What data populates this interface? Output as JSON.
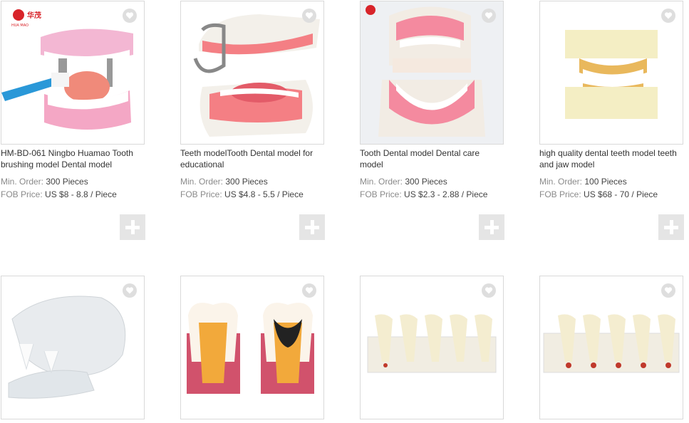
{
  "products": [
    {
      "title": "HM-BD-061 Ningbo Huamao Tooth brushing model Dental model",
      "min_order_label": "Min. Order:",
      "min_order": "300 Pieces",
      "price_label": "FOB Price:",
      "price": "US $8 - 8.8 / Piece",
      "logo_text": "华茂",
      "logo_sub": "HUA MAO"
    },
    {
      "title": "Teeth modelTooth Dental model for educational",
      "min_order_label": "Min. Order:",
      "min_order": "300 Pieces",
      "price_label": "FOB Price:",
      "price": "US $4.8 - 5.5 / Piece"
    },
    {
      "title": "Tooth Dental model Dental care model",
      "min_order_label": "Min. Order:",
      "min_order": "300 Pieces",
      "price_label": "FOB Price:",
      "price": "US $2.3 - 2.88 / Piece"
    },
    {
      "title": "high quality dental teeth model teeth and jaw model",
      "min_order_label": "Min. Order:",
      "min_order": "100 Pieces",
      "price_label": "FOB Price:",
      "price": "US $68 - 70 / Piece"
    },
    {},
    {},
    {},
    {}
  ],
  "icons": {
    "favorite": "heart-icon",
    "add": "plus-icon"
  }
}
